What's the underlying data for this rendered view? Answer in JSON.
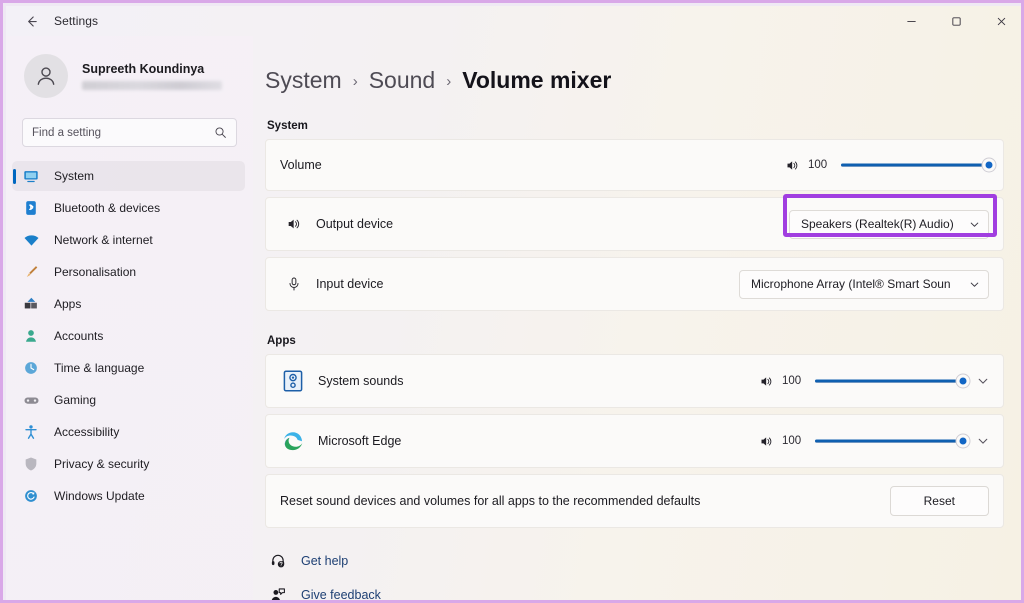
{
  "window": {
    "app_title": "Settings",
    "back_icon": "arrow-left-icon",
    "controls": {
      "minimize": "minimize-icon",
      "maximize": "maximize-icon",
      "close": "close-icon"
    }
  },
  "sidebar": {
    "profile": {
      "name": "Supreeth Koundinya",
      "email_redacted": "",
      "avatar_icon": "person-icon"
    },
    "search": {
      "placeholder": "Find a setting",
      "value": "",
      "icon": "search-icon"
    },
    "items": [
      {
        "label": "System",
        "icon": "monitor-icon",
        "selected": true
      },
      {
        "label": "Bluetooth & devices",
        "icon": "bluetooth-icon",
        "selected": false
      },
      {
        "label": "Network & internet",
        "icon": "wifi-icon",
        "selected": false
      },
      {
        "label": "Personalisation",
        "icon": "brush-icon",
        "selected": false
      },
      {
        "label": "Apps",
        "icon": "apps-icon",
        "selected": false
      },
      {
        "label": "Accounts",
        "icon": "account-icon",
        "selected": false
      },
      {
        "label": "Time & language",
        "icon": "clock-icon",
        "selected": false
      },
      {
        "label": "Gaming",
        "icon": "gamepad-icon",
        "selected": false
      },
      {
        "label": "Accessibility",
        "icon": "accessibility-icon",
        "selected": false
      },
      {
        "label": "Privacy & security",
        "icon": "shield-icon",
        "selected": false
      },
      {
        "label": "Windows Update",
        "icon": "update-icon",
        "selected": false
      }
    ]
  },
  "breadcrumb": {
    "crumb1": "System",
    "crumb2": "Sound",
    "crumb3": "Volume mixer",
    "separator": "›"
  },
  "system_section": {
    "label": "System",
    "volume_row": {
      "label": "Volume",
      "speaker_icon": "speaker-icon",
      "value": "100",
      "percent": 100
    },
    "output_row": {
      "label": "Output device",
      "icon": "speaker-icon",
      "selected": "Speakers (Realtek(R) Audio)",
      "chevron": "chevron-down-icon",
      "highlighted": true
    },
    "input_row": {
      "label": "Input device",
      "icon": "microphone-icon",
      "selected": "Microphone Array (Intel® Smart Soun",
      "chevron": "chevron-down-icon"
    }
  },
  "apps_section": {
    "label": "Apps",
    "rows": [
      {
        "label": "System sounds",
        "app_icon": "system-sounds-icon",
        "speaker_icon": "speaker-icon",
        "value": "100",
        "percent": 100,
        "chevron": "chevron-down-icon"
      },
      {
        "label": "Microsoft Edge",
        "app_icon": "microsoft-edge-icon",
        "speaker_icon": "speaker-icon",
        "value": "100",
        "percent": 100,
        "chevron": "chevron-down-icon"
      }
    ],
    "reset_row": {
      "description": "Reset sound devices and volumes for all apps to the recommended defaults",
      "button_label": "Reset"
    }
  },
  "footer_links": [
    {
      "label": "Get help",
      "icon": "help-icon"
    },
    {
      "label": "Give feedback",
      "icon": "feedback-icon"
    }
  ],
  "colors": {
    "accent_blue": "#0067c0",
    "slider_blue": "#0f5fb0",
    "annotation_purple": "#a13ee0",
    "link_blue": "#1d3f73"
  }
}
